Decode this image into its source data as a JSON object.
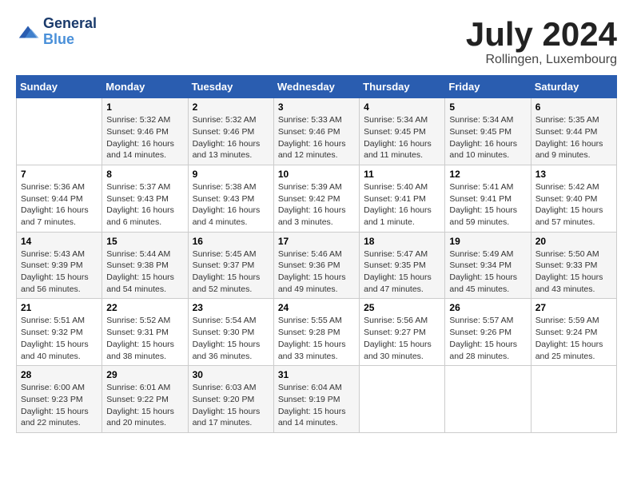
{
  "header": {
    "logo_line1": "General",
    "logo_line2": "Blue",
    "month_title": "July 2024",
    "location": "Rollingen, Luxembourg"
  },
  "weekdays": [
    "Sunday",
    "Monday",
    "Tuesday",
    "Wednesday",
    "Thursday",
    "Friday",
    "Saturday"
  ],
  "weeks": [
    [
      null,
      {
        "day": 1,
        "sunrise": "5:32 AM",
        "sunset": "9:46 PM",
        "daylight": "16 hours and 14 minutes."
      },
      {
        "day": 2,
        "sunrise": "5:32 AM",
        "sunset": "9:46 PM",
        "daylight": "16 hours and 13 minutes."
      },
      {
        "day": 3,
        "sunrise": "5:33 AM",
        "sunset": "9:46 PM",
        "daylight": "16 hours and 12 minutes."
      },
      {
        "day": 4,
        "sunrise": "5:34 AM",
        "sunset": "9:45 PM",
        "daylight": "16 hours and 11 minutes."
      },
      {
        "day": 5,
        "sunrise": "5:34 AM",
        "sunset": "9:45 PM",
        "daylight": "16 hours and 10 minutes."
      },
      {
        "day": 6,
        "sunrise": "5:35 AM",
        "sunset": "9:44 PM",
        "daylight": "16 hours and 9 minutes."
      }
    ],
    [
      {
        "day": 7,
        "sunrise": "5:36 AM",
        "sunset": "9:44 PM",
        "daylight": "16 hours and 7 minutes."
      },
      {
        "day": 8,
        "sunrise": "5:37 AM",
        "sunset": "9:43 PM",
        "daylight": "16 hours and 6 minutes."
      },
      {
        "day": 9,
        "sunrise": "5:38 AM",
        "sunset": "9:43 PM",
        "daylight": "16 hours and 4 minutes."
      },
      {
        "day": 10,
        "sunrise": "5:39 AM",
        "sunset": "9:42 PM",
        "daylight": "16 hours and 3 minutes."
      },
      {
        "day": 11,
        "sunrise": "5:40 AM",
        "sunset": "9:41 PM",
        "daylight": "16 hours and 1 minute."
      },
      {
        "day": 12,
        "sunrise": "5:41 AM",
        "sunset": "9:41 PM",
        "daylight": "15 hours and 59 minutes."
      },
      {
        "day": 13,
        "sunrise": "5:42 AM",
        "sunset": "9:40 PM",
        "daylight": "15 hours and 57 minutes."
      }
    ],
    [
      {
        "day": 14,
        "sunrise": "5:43 AM",
        "sunset": "9:39 PM",
        "daylight": "15 hours and 56 minutes."
      },
      {
        "day": 15,
        "sunrise": "5:44 AM",
        "sunset": "9:38 PM",
        "daylight": "15 hours and 54 minutes."
      },
      {
        "day": 16,
        "sunrise": "5:45 AM",
        "sunset": "9:37 PM",
        "daylight": "15 hours and 52 minutes."
      },
      {
        "day": 17,
        "sunrise": "5:46 AM",
        "sunset": "9:36 PM",
        "daylight": "15 hours and 49 minutes."
      },
      {
        "day": 18,
        "sunrise": "5:47 AM",
        "sunset": "9:35 PM",
        "daylight": "15 hours and 47 minutes."
      },
      {
        "day": 19,
        "sunrise": "5:49 AM",
        "sunset": "9:34 PM",
        "daylight": "15 hours and 45 minutes."
      },
      {
        "day": 20,
        "sunrise": "5:50 AM",
        "sunset": "9:33 PM",
        "daylight": "15 hours and 43 minutes."
      }
    ],
    [
      {
        "day": 21,
        "sunrise": "5:51 AM",
        "sunset": "9:32 PM",
        "daylight": "15 hours and 40 minutes."
      },
      {
        "day": 22,
        "sunrise": "5:52 AM",
        "sunset": "9:31 PM",
        "daylight": "15 hours and 38 minutes."
      },
      {
        "day": 23,
        "sunrise": "5:54 AM",
        "sunset": "9:30 PM",
        "daylight": "15 hours and 36 minutes."
      },
      {
        "day": 24,
        "sunrise": "5:55 AM",
        "sunset": "9:28 PM",
        "daylight": "15 hours and 33 minutes."
      },
      {
        "day": 25,
        "sunrise": "5:56 AM",
        "sunset": "9:27 PM",
        "daylight": "15 hours and 30 minutes."
      },
      {
        "day": 26,
        "sunrise": "5:57 AM",
        "sunset": "9:26 PM",
        "daylight": "15 hours and 28 minutes."
      },
      {
        "day": 27,
        "sunrise": "5:59 AM",
        "sunset": "9:24 PM",
        "daylight": "15 hours and 25 minutes."
      }
    ],
    [
      {
        "day": 28,
        "sunrise": "6:00 AM",
        "sunset": "9:23 PM",
        "daylight": "15 hours and 22 minutes."
      },
      {
        "day": 29,
        "sunrise": "6:01 AM",
        "sunset": "9:22 PM",
        "daylight": "15 hours and 20 minutes."
      },
      {
        "day": 30,
        "sunrise": "6:03 AM",
        "sunset": "9:20 PM",
        "daylight": "15 hours and 17 minutes."
      },
      {
        "day": 31,
        "sunrise": "6:04 AM",
        "sunset": "9:19 PM",
        "daylight": "15 hours and 14 minutes."
      },
      null,
      null,
      null
    ]
  ]
}
